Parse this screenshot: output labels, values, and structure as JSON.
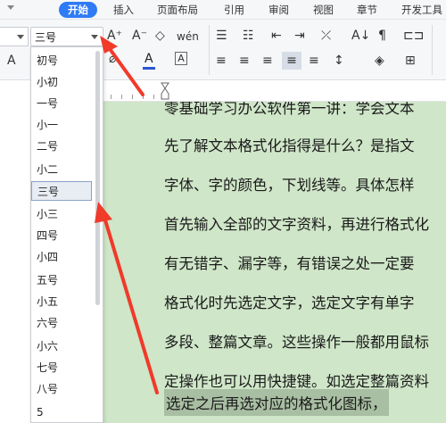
{
  "menubar": {
    "items": [
      "开始",
      "插入",
      "页面布局",
      "引用",
      "审阅",
      "视图",
      "章节",
      "开发工具"
    ]
  },
  "ribbon": {
    "font_size_value": "三号",
    "icons": {
      "grow_font": "A⁺",
      "shrink_font": "A⁻",
      "clear_format": "◇",
      "phonetic": "wén",
      "bullets": "☰",
      "numbering": "☷",
      "indent_dec": "⇤",
      "indent_inc": "⇥",
      "text_direction": "⤫",
      "sort": "A↓",
      "show_marks": "¶",
      "char_border": "A",
      "font_color": "A",
      "highlight": "✎",
      "char_shading": "A",
      "align_left": "≡",
      "align_center": "≡",
      "align_right": "≡",
      "justify": "≡",
      "distribute": "≡",
      "line_spacing": "↕",
      "shading": "◈",
      "borders": "⊞"
    },
    "accent_color": "#2f7bf5",
    "font_color_bar": "#e03a2a",
    "highlight_color_bar": "#2a56d4"
  },
  "dropdown": {
    "options": [
      "初号",
      "小初",
      "一号",
      "小一",
      "二号",
      "小二",
      "三号",
      "小三",
      "四号",
      "小四",
      "五号",
      "小五",
      "六号",
      "小六",
      "七号",
      "八号",
      "5"
    ],
    "selected_index": 6
  },
  "document": {
    "lines": [
      "零基础学习办公软件第一讲：学会文本",
      "先了解文本格式化指得是什么？是指文",
      "字体、字的颜色，下划线等。具体怎样",
      "首先输入全部的文字资料，再进行格式化",
      "有无错字、漏字等，有错误之处一定要",
      "格式化时先选定文字，选定文字有单字",
      "多段、整篇文章。这些操作一般都用鼠标",
      "定操作也可以用快捷键。如选定整篇资料",
      "选定之后再选对应的格式化图标，"
    ],
    "background": "#cfe6c8",
    "annotation_color": "#f03a2a"
  }
}
